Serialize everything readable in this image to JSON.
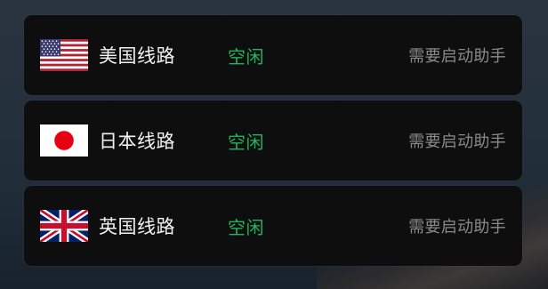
{
  "routes": [
    {
      "flag": "us-flag-icon",
      "name": "美国线路",
      "status": "空闲",
      "hint": "需要启动助手"
    },
    {
      "flag": "jp-flag-icon",
      "name": "日本线路",
      "status": "空闲",
      "hint": "需要启动助手"
    },
    {
      "flag": "uk-flag-icon",
      "name": "英国线路",
      "status": "空闲",
      "hint": "需要启动助手"
    }
  ],
  "colors": {
    "row_bg": "#0e0e0f",
    "status_idle": "#23b35a",
    "hint_text": "#8a8a8a",
    "name_text": "#f2f2f2"
  }
}
